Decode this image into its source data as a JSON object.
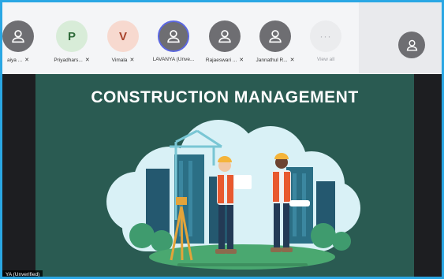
{
  "participants": [
    {
      "name": "aiya ...",
      "avatar": "person-icon",
      "mic": "mic-off-icon"
    },
    {
      "name": "Priyadhars...",
      "initial": "P",
      "avatar_bg": "#d8ecd8",
      "avatar_fg": "#2f6b3a",
      "mic": "mic-off-icon"
    },
    {
      "name": "Vimala",
      "initial": "V",
      "avatar_bg": "#f7d9cf",
      "avatar_fg": "#a8432b",
      "mic": "mic-off-icon"
    },
    {
      "name": "LAVANYA (Unve...",
      "avatar": "person-icon",
      "mic": "none",
      "highlighted": true
    },
    {
      "name": "Rajaeswari ...",
      "avatar": "person-icon",
      "mic": "mic-off-icon"
    },
    {
      "name": "Jannathul R...",
      "avatar": "person-icon",
      "mic": "mic-off-icon"
    },
    {
      "name": "View all",
      "avatar": "more-icon",
      "mic": "none"
    }
  ],
  "view_all_glyph": "···",
  "mic_glyph": "🎙",
  "mic_off_glyph": "ꟾ",
  "slide": {
    "title": "CONSTRUCTION MANAGEMENT"
  },
  "presenter_tag": "YA (Unverified)",
  "colors": {
    "accent_border": "#2aa7e4",
    "slide_bg": "#2a5b52",
    "avatar_gray": "#6e6e72"
  }
}
